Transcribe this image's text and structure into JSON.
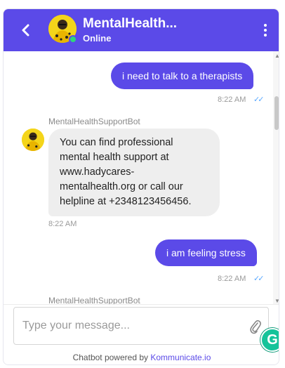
{
  "header": {
    "title": "MentalHealth...",
    "status": "Online",
    "icons": {
      "back": "chevron-left-icon",
      "menu": "more-vertical-icon"
    }
  },
  "messages": [
    {
      "from": "user",
      "text": "i need to talk to a therapists",
      "time": "8:22 AM",
      "read": true
    },
    {
      "from": "bot",
      "sender": "MentalHealthSupportBot",
      "lines": [
        "You can find professional",
        "mental health support at",
        "www.hadycares-",
        "mentalhealth.org or call our",
        "helpline at +2348123456456."
      ],
      "time": "8:22 AM"
    },
    {
      "from": "user",
      "text": "i am feeling stress",
      "time": "8:22 AM",
      "read": true
    },
    {
      "from": "bot",
      "sender": "MentalHealthSupportBot"
    }
  ],
  "composer": {
    "placeholder": "Type your message...",
    "icons": {
      "attach": "paperclip-icon",
      "grammarly": "grammarly-icon"
    },
    "grammarly_letter": "G"
  },
  "footer": {
    "prefix": "Chatbot powered by ",
    "brand": "Kommunicate.io"
  },
  "colors": {
    "accent": "#5b4ae8",
    "online": "#2fd67c",
    "read_ticks": "#5aa9ff"
  }
}
